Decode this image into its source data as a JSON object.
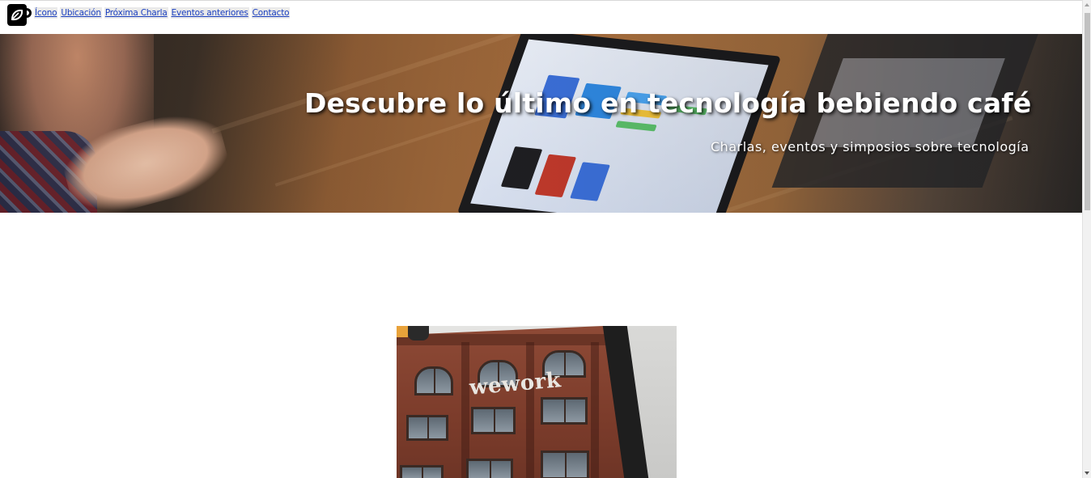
{
  "nav": {
    "logo_icon": "coffee-leaf-icon",
    "links": [
      {
        "label": "Ícono"
      },
      {
        "label": "Ubicación"
      },
      {
        "label": "Próxima Charla"
      },
      {
        "label": "Eventos anteriores"
      },
      {
        "label": "Contacto"
      }
    ]
  },
  "hero": {
    "title": "Descubre lo último en tecnología bebiendo café",
    "subtitle": "Charlas, eventos y simposios sobre tecnología"
  },
  "location": {
    "sign_text": "wework"
  },
  "colors": {
    "link": "#1a3fbf",
    "hero_text": "#ffffff",
    "page_bg": "#ffffff"
  }
}
